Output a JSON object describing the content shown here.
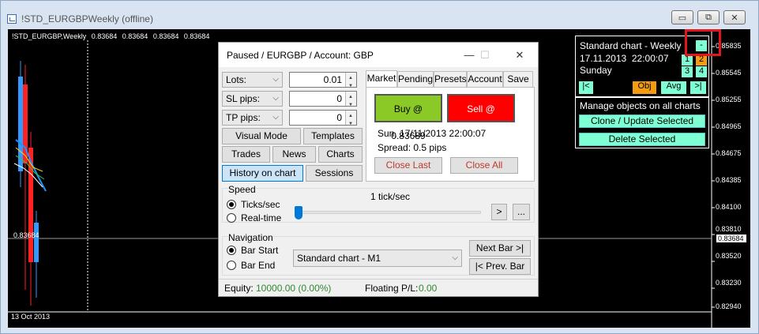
{
  "window": {
    "title": "!STD_EURGBPWeekly (offline)",
    "controls": {
      "minimize": "▭",
      "restore": "⧉",
      "close": "✕"
    }
  },
  "chart": {
    "header": {
      "symbol": "!STD_EURGBP,Weekly",
      "ohlc": [
        "0.83684",
        "0.83684",
        "0.83684",
        "0.83684"
      ]
    },
    "price_levels": [
      "0.85835",
      "0.85545",
      "0.85255",
      "0.84965",
      "0.84675",
      "0.84385",
      "0.84100",
      "0.83810",
      "0.83520",
      "0.83230",
      "0.82940"
    ],
    "current_price": "0.83684",
    "left_price": "0.83684",
    "date_label": "13 Oct 2013"
  },
  "info_panel": {
    "line1": "Standard chart - Weekly",
    "minus_button": "-",
    "date": "17.11.2013",
    "time": "22:00:07",
    "day": "Sunday",
    "num_buttons": [
      "1",
      "2",
      "3",
      "4"
    ],
    "first_button": "|<",
    "obj_button": "Obj",
    "avg_button": "Avg",
    "last_button": ">|"
  },
  "manage_panel": {
    "title": "Manage objects on all charts",
    "clone_button": "Clone / Update Selected",
    "delete_button": "Delete Selected"
  },
  "dialog": {
    "title": "Paused / EURGBP / Account: GBP",
    "lots": {
      "label": "Lots:",
      "value": "0.01"
    },
    "sl": {
      "label": "SL pips:",
      "value": "0"
    },
    "tp": {
      "label": "TP pips:",
      "value": "0"
    },
    "buttons": {
      "visual_mode": "Visual Mode",
      "templates": "Templates",
      "trades": "Trades",
      "news": "News",
      "charts": "Charts",
      "history": "History on chart",
      "sessions": "Sessions"
    },
    "tabs": [
      "Market",
      "Pending",
      "Presets",
      "Account",
      "Save"
    ],
    "market": {
      "buy": "Buy @ 0.83689",
      "sell": "Sell @ 0.83684",
      "datetime": "Sun, 17/11/2013  22:00:07",
      "spread": "Spread: 0.5 pips",
      "close_last": "Close Last",
      "close_all": "Close All"
    },
    "speed": {
      "title": "Speed",
      "rate": "1 tick/sec",
      "ticks": "Ticks/sec",
      "realtime": "Real-time",
      "play": ">",
      "more": "...",
      "slider_fraction": 0.0
    },
    "navigation": {
      "title": "Navigation",
      "bar_start": "Bar Start",
      "bar_end": "Bar End",
      "chart_select": "Standard chart - M1",
      "next_bar": "Next Bar >|",
      "prev_bar": "|< Prev. Bar"
    },
    "status": {
      "equity_label": "Equity:",
      "equity_value": "10000.00  (0.00%)",
      "pl_label": "Floating P/L:",
      "pl_value": "0.00"
    }
  },
  "colors": {
    "buy": "#8ac926",
    "sell": "#ff0000",
    "aqua": "#7fffd4",
    "orange": "#f39c12",
    "highlight": "#e4161b",
    "green_text": "#2e8b2e"
  }
}
